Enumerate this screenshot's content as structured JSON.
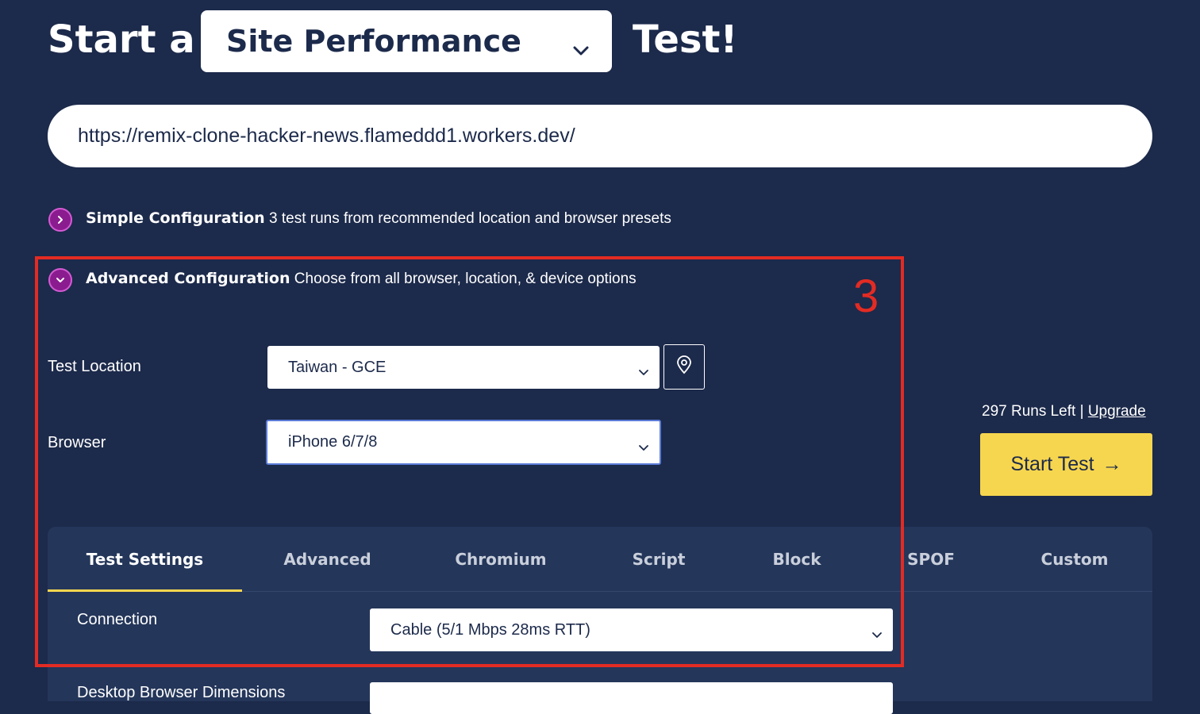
{
  "heading": {
    "prefix": "Start a",
    "test_type": "Site Performance",
    "suffix": "Test!"
  },
  "url_input": {
    "value": "https://remix-clone-hacker-news.flameddd1.workers.dev/"
  },
  "simple_config": {
    "title": "Simple Configuration",
    "description": "3 test runs from recommended location and browser presets"
  },
  "advanced_config": {
    "title": "Advanced Configuration",
    "description": "Choose from all browser, location, & device options"
  },
  "annotation": {
    "label": "3",
    "color": "#e32b23"
  },
  "test_location": {
    "label": "Test Location",
    "value": "Taiwan - GCE"
  },
  "browser": {
    "label": "Browser",
    "value": "iPhone 6/7/8"
  },
  "runs": {
    "text": "297 Runs Left",
    "separator": "|",
    "upgrade": "Upgrade"
  },
  "start_button": {
    "label": "Start Test",
    "arrow": "→"
  },
  "tabs": [
    {
      "label": "Test Settings",
      "active": true
    },
    {
      "label": "Advanced",
      "active": false
    },
    {
      "label": "Chromium",
      "active": false
    },
    {
      "label": "Script",
      "active": false
    },
    {
      "label": "Block",
      "active": false
    },
    {
      "label": "SPOF",
      "active": false
    },
    {
      "label": "Custom",
      "active": false
    }
  ],
  "connection": {
    "label": "Connection",
    "value": "Cable (5/1 Mbps 28ms RTT)"
  },
  "desktop_dimensions": {
    "label": "Desktop Browser Dimensions"
  },
  "colors": {
    "background": "#1c2a4b",
    "accent_yellow": "#f7d64f",
    "accent_purple": "#8b1c8f"
  },
  "icons": [
    "chevron-down-icon",
    "chevron-right-icon",
    "map-pin-icon",
    "arrow-right-icon"
  ]
}
